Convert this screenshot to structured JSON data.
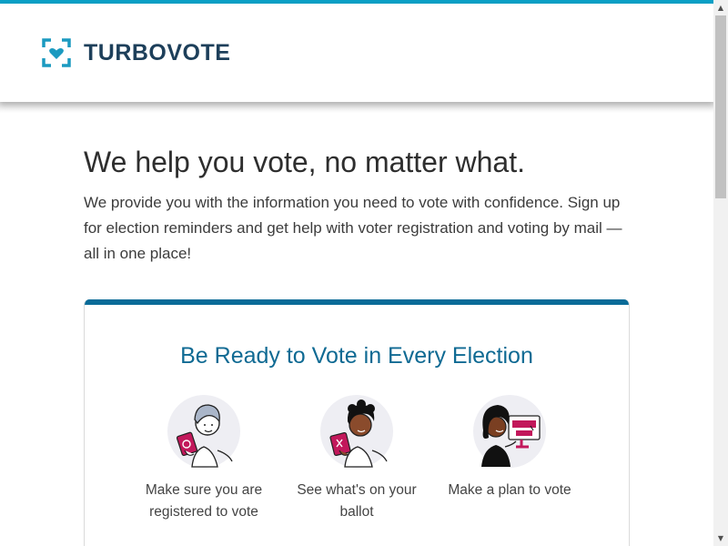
{
  "header": {
    "brand": "TURBOVOTE",
    "logo_icon": "turbovote-bracket-heart-logo",
    "accent_color": "#0aa0c6",
    "brand_color": "#1d3f5a"
  },
  "main": {
    "heading": "We help you vote, no matter what.",
    "intro": "We provide you with the information you need to vote with confidence. Sign up for election reminders and get help with voter registration and voting by mail — all in one place!"
  },
  "card": {
    "title": "Be Ready to Vote in Every Election",
    "bar_color": "#0a6b98",
    "features": [
      {
        "label": "Make sure you are registered to vote",
        "icon": "person-holding-registration-card-icon"
      },
      {
        "label": "See what's on your ballot",
        "icon": "person-holding-ballot-icon"
      },
      {
        "label": "Make a plan to vote",
        "icon": "person-at-computer-icon"
      }
    ]
  },
  "scrollbar": {
    "up_icon": "scroll-up-arrow-icon",
    "down_icon": "scroll-down-arrow-icon"
  }
}
